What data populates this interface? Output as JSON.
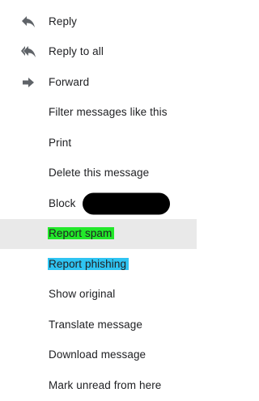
{
  "menu": {
    "items": [
      {
        "label": "Reply",
        "icon": "reply-icon"
      },
      {
        "label": "Reply to all",
        "icon": "reply-all-icon"
      },
      {
        "label": "Forward",
        "icon": "forward-icon"
      },
      {
        "label": "Filter messages like this"
      },
      {
        "label": "Print"
      },
      {
        "label": "Delete this message"
      },
      {
        "label": "Block",
        "redacted": true
      },
      {
        "label": "Report spam",
        "highlight": "#22e82a",
        "hovered": true
      },
      {
        "label": "Report phishing",
        "highlight": "#2fc4f2"
      },
      {
        "label": "Show original"
      },
      {
        "label": "Translate message"
      },
      {
        "label": "Download message"
      },
      {
        "label": "Mark unread from here"
      }
    ]
  },
  "colors": {
    "text": "#202124",
    "icon": "#5f6368",
    "hover_background": "#e9e9e9",
    "spam_highlight": "#22e82a",
    "phishing_highlight": "#2fc4f2",
    "redaction": "#000000"
  }
}
